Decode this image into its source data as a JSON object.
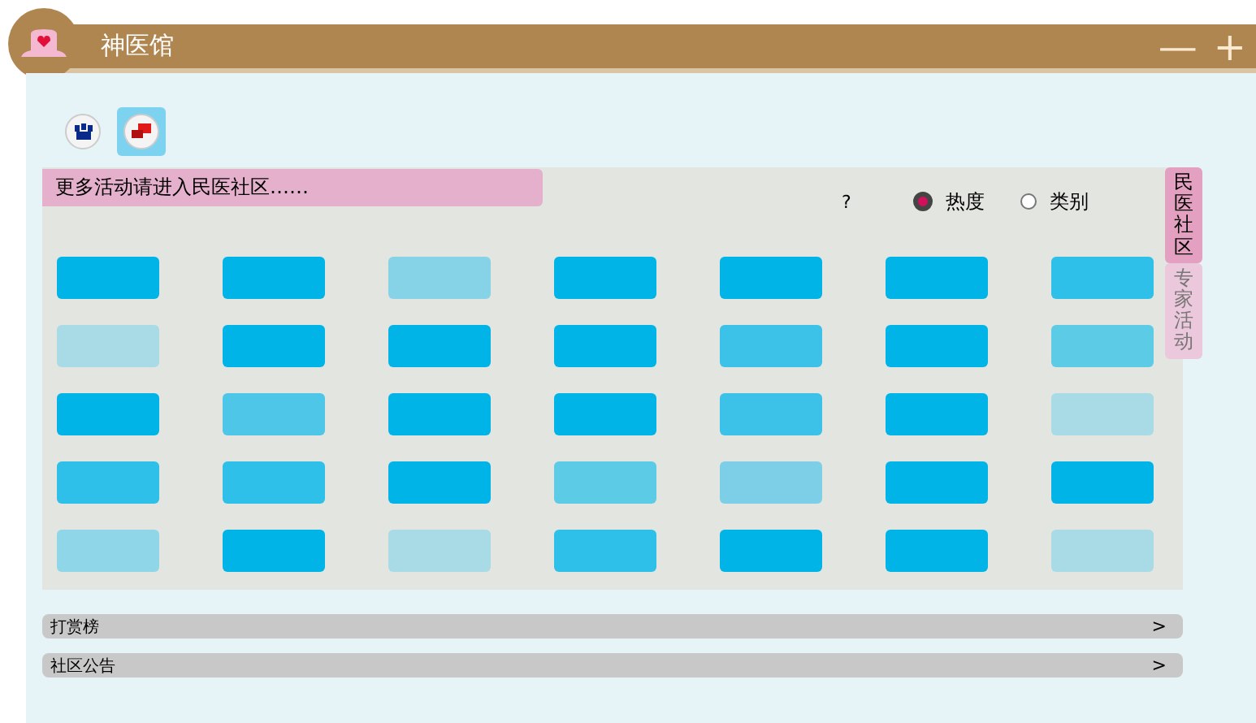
{
  "window": {
    "title": "神医馆",
    "buttons": [
      "—",
      "+"
    ]
  },
  "toolbar": [
    {
      "selected": false
    },
    {
      "selected": true
    }
  ],
  "banner": "更多活动请进入民医社区……",
  "help": "?",
  "sort_options": [
    {
      "label": "热度",
      "selected": true
    },
    {
      "label": "类别",
      "selected": false
    }
  ],
  "side_tabs": [
    {
      "label": "民医社区",
      "selected": true
    },
    {
      "label": "专家活动",
      "selected": false
    }
  ],
  "tiles": [
    [
      {
        "color": "#00b4e8"
      },
      {
        "color": "#00b4e8"
      },
      {
        "color": "#86d3e8"
      },
      {
        "color": "#00b4e8"
      },
      {
        "color": "#00b4e8"
      },
      {
        "color": "#00b4e8"
      },
      {
        "color": "#2ec0e8"
      }
    ],
    [
      {
        "color": "#a8dbe6"
      },
      {
        "color": "#00b4e8"
      },
      {
        "color": "#00b4e8"
      },
      {
        "color": "#00b4e8"
      },
      {
        "color": "#3cc2e8"
      },
      {
        "color": "#00b4e8"
      },
      {
        "color": "#5ccbe6"
      }
    ],
    [
      {
        "color": "#00b4e8"
      },
      {
        "color": "#4ec6e8"
      },
      {
        "color": "#00b4e8"
      },
      {
        "color": "#00b4e8"
      },
      {
        "color": "#3cc2e8"
      },
      {
        "color": "#00b4e8"
      },
      {
        "color": "#a8dbe6"
      }
    ],
    [
      {
        "color": "#2ec0e8"
      },
      {
        "color": "#2ec0e8"
      },
      {
        "color": "#00b4e8"
      },
      {
        "color": "#5ccbe6"
      },
      {
        "color": "#7ccfe6"
      },
      {
        "color": "#00b4e8"
      },
      {
        "color": "#00b4e8"
      }
    ],
    [
      {
        "color": "#8ed6e8"
      },
      {
        "color": "#00b4e8"
      },
      {
        "color": "#a8dbe6"
      },
      {
        "color": "#2ec0e8"
      },
      {
        "color": "#00b4e8"
      },
      {
        "color": "#00b4e8"
      },
      {
        "color": "#a8dbe6"
      }
    ]
  ],
  "sections": [
    {
      "label": "打赏榜",
      "arrow": ">"
    },
    {
      "label": "社区公告",
      "arrow": ">"
    }
  ]
}
